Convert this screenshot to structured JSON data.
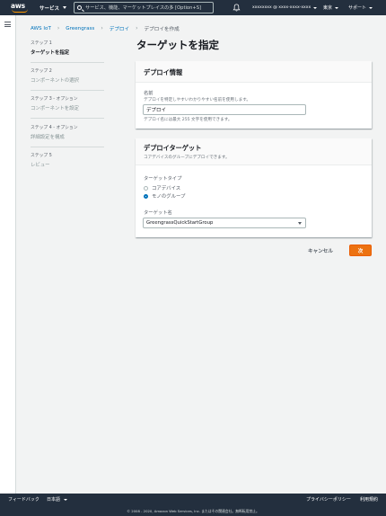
{
  "nav": {
    "logo": "aws",
    "services_label": "サービス",
    "search_placeholder": "サービス、機能、マーケットプレイスの多 [Option+S]",
    "account_label": "xxxxxxxx @ xxxx-xxxx-xxxx",
    "region_label": "東京",
    "support_label": "サポート"
  },
  "breadcrumb": [
    "AWS IoT",
    "Greengrass",
    "デプロイ",
    "デプロイを作成"
  ],
  "steps": [
    {
      "number": "ステップ 1",
      "title": "ターゲットを指定",
      "active": true
    },
    {
      "number": "ステップ 2",
      "title": "コンポーネントの選択",
      "active": false
    },
    {
      "number": "ステップ 3 - オプション",
      "title": "コンポーネントを設定",
      "active": false
    },
    {
      "number": "ステップ 4 - オプション",
      "title": "詳細設定を構成",
      "active": false
    },
    {
      "number": "ステップ 5",
      "title": "レビュー",
      "active": false
    }
  ],
  "page_title": "ターゲットを指定",
  "deploy_info": {
    "title": "デプロイ情報",
    "name_label": "名前",
    "name_desc": "デプロイを特定しやすいわかりやすい名前を使用します。",
    "name_value": "デプロイ",
    "name_hint": "デプロイ名には最大 255 文字を使用できます。"
  },
  "deploy_target": {
    "title": "デプロイターゲット",
    "desc": "コアデバイスのグループにデプロイできます。",
    "type_label": "ターゲットタイプ",
    "options": [
      {
        "label": "コアデバイス",
        "checked": false
      },
      {
        "label": "モノのグループ",
        "checked": true
      }
    ],
    "target_name_label": "ターゲット名",
    "target_name_value": "GreengrassQuickStartGroup"
  },
  "actions": {
    "cancel": "キャンセル",
    "next": "次"
  },
  "footer": {
    "feedback": "フィードバック",
    "language": "日本語",
    "privacy": "プライバシーポリシー",
    "terms": "利用規約",
    "copyright": "© 2008 - 2020, Amazon Web Services, Inc. またはその関連会社。無断転用禁止。"
  },
  "colors": {
    "nav_bg": "#232f3e",
    "accent": "#ec7211",
    "link": "#0073bb",
    "page_bg": "#f2f3f3"
  }
}
